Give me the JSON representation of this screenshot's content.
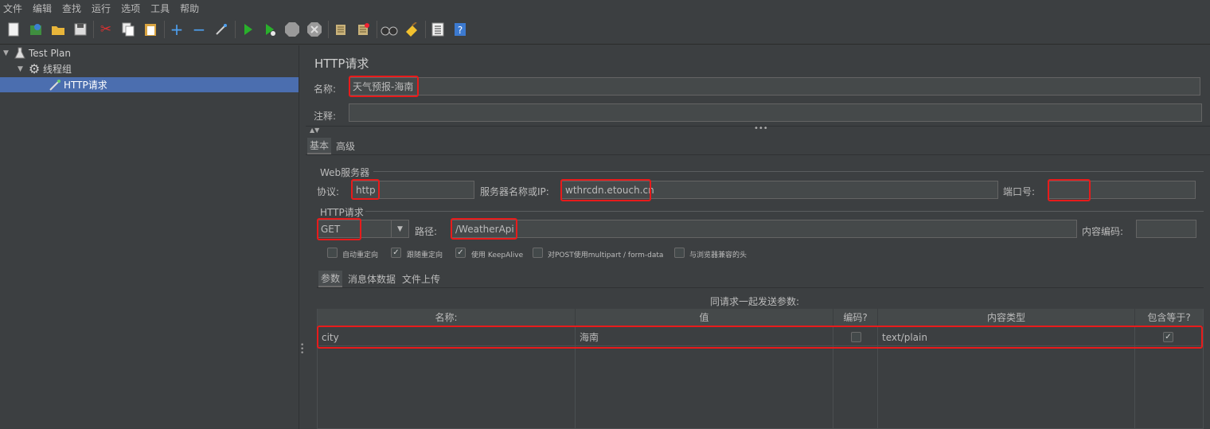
{
  "menu": [
    "文件",
    "编辑",
    "查找",
    "运行",
    "选项",
    "工具",
    "帮助"
  ],
  "toolbar": {
    "icons": [
      "new-icon",
      "templates-icon",
      "open-icon",
      "save-icon",
      "cut-icon",
      "copy-icon",
      "paste-icon",
      "expand-icon",
      "collapse-icon",
      "toggle-icon",
      "start-icon",
      "start-no-pause-icon",
      "stop-icon",
      "shutdown-icon",
      "clear-icon",
      "clear-all-icon",
      "search-icon",
      "reset-search-icon",
      "function-helper-icon",
      "help-icon"
    ]
  },
  "tree": {
    "items": [
      {
        "label": "Test Plan",
        "icon": "flask-icon",
        "expanded": true
      },
      {
        "label": "线程组",
        "icon": "gear-icon",
        "expanded": true
      },
      {
        "label": "HTTP请求",
        "icon": "pipette-icon",
        "selected": true
      }
    ]
  },
  "panel": {
    "title": "HTTP请求",
    "name_label": "名称:",
    "name_value": "天气预报-海南",
    "comment_label": "注释:",
    "comment_value": "",
    "tabs": [
      "基本",
      "高级"
    ],
    "web_server": {
      "group_title": "Web服务器",
      "protocol_label": "协议:",
      "protocol_value": "http",
      "server_label": "服务器名称或IP:",
      "server_value": "wthrcdn.etouch.cn",
      "port_label": "端口号:",
      "port_value": ""
    },
    "http_request": {
      "group_title": "HTTP请求",
      "method_value": "GET",
      "path_label": "路径:",
      "path_value": "/WeatherApi",
      "encoding_label": "内容编码:",
      "encoding_value": ""
    },
    "options": [
      {
        "label": "自动重定向",
        "checked": false
      },
      {
        "label": "跟随重定向",
        "checked": true
      },
      {
        "label": "使用 KeepAlive",
        "checked": true
      },
      {
        "label": "对POST使用multipart / form-data",
        "checked": false
      },
      {
        "label": "与浏览器兼容的头",
        "checked": false
      }
    ],
    "sub_tabs": [
      "参数",
      "消息体数据",
      "文件上传"
    ],
    "params": {
      "title": "同请求一起发送参数:",
      "columns": [
        "名称:",
        "值",
        "编码?",
        "内容类型",
        "包含等于?"
      ],
      "rows": [
        {
          "name": "city",
          "value": "海南",
          "encode": false,
          "content_type": "text/plain",
          "include_equals": true
        }
      ]
    }
  },
  "colors": {
    "background": "#3c3f41",
    "selection": "#4b6eaf",
    "highlight": "#e81b1b",
    "field": "#45494a"
  }
}
